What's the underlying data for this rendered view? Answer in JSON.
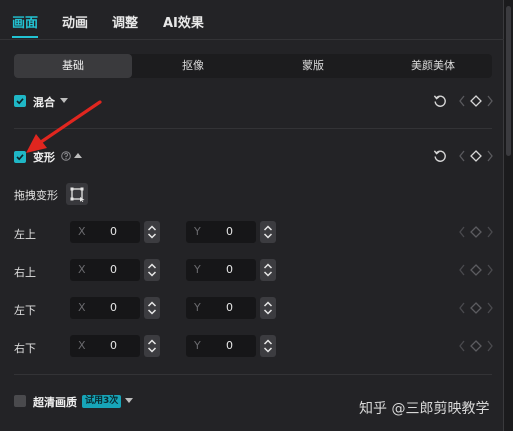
{
  "top_tabs": [
    {
      "label": "画面",
      "active": true
    },
    {
      "label": "动画",
      "active": false
    },
    {
      "label": "调整",
      "active": false
    },
    {
      "label": "AI效果",
      "active": false
    }
  ],
  "sub_tabs": [
    {
      "label": "基础",
      "active": true
    },
    {
      "label": "抠像",
      "active": false
    },
    {
      "label": "蒙版",
      "active": false
    },
    {
      "label": "美颜美体",
      "active": false
    }
  ],
  "blend": {
    "label": "混合",
    "checked": true
  },
  "transform": {
    "label": "变形",
    "checked": true,
    "drag_label": "拖拽变形",
    "rows": [
      {
        "label": "左上",
        "x_axis": "X",
        "x": "0",
        "y_axis": "Y",
        "y": "0"
      },
      {
        "label": "右上",
        "x_axis": "X",
        "x": "0",
        "y_axis": "Y",
        "y": "0"
      },
      {
        "label": "左下",
        "x_axis": "X",
        "x": "0",
        "y_axis": "Y",
        "y": "0"
      },
      {
        "label": "右下",
        "x_axis": "X",
        "x": "0",
        "y_axis": "Y",
        "y": "0"
      }
    ]
  },
  "hd": {
    "label": "超清画质",
    "checked": false,
    "badge": "试用3次"
  },
  "watermark": "知乎 @三郎剪映教学",
  "colors": {
    "accent": "#22c3d3",
    "panel": "#232326",
    "annotation_arrow": "#e0261f"
  }
}
